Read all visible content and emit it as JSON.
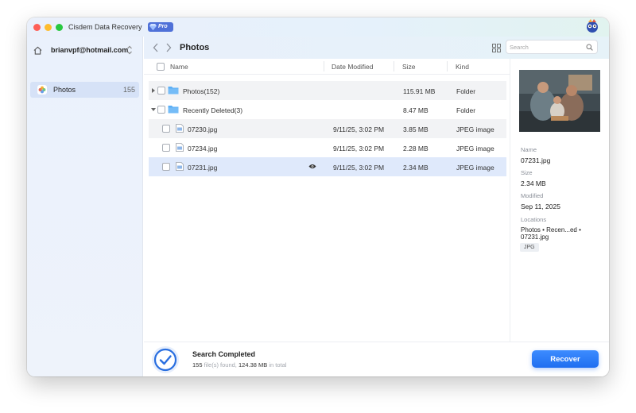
{
  "window": {
    "title": "Cisdem Data Recovery",
    "badge": "Pro"
  },
  "sidebar": {
    "account_email": "brianvpf@hotmail.com",
    "items": [
      {
        "label": "Photos",
        "count": "155",
        "icon": "photos-app-icon",
        "selected": true
      }
    ]
  },
  "toolbar": {
    "title": "Photos",
    "search_placeholder": "Search"
  },
  "table": {
    "columns": [
      "Name",
      "Date Modified",
      "Size",
      "Kind"
    ],
    "rows": [
      {
        "name": "Photos(152)",
        "date": "",
        "size": "115.91 MB",
        "kind": "Folder",
        "type": "folder",
        "expanded": false
      },
      {
        "name": "Recently Deleted(3)",
        "date": "",
        "size": "8.47 MB",
        "kind": "Folder",
        "type": "folder",
        "expanded": true
      },
      {
        "name": "07230.jpg",
        "date": "9/11/25, 3:02 PM",
        "size": "3.85 MB",
        "kind": "JPEG image",
        "type": "file"
      },
      {
        "name": "07234.jpg",
        "date": "9/11/25, 3:02 PM",
        "size": "2.28 MB",
        "kind": "JPEG image",
        "type": "file"
      },
      {
        "name": "07231.jpg",
        "date": "9/11/25, 3:02 PM",
        "size": "2.34 MB",
        "kind": "JPEG image",
        "type": "file",
        "selected": true
      }
    ]
  },
  "details": {
    "name_label": "Name",
    "name_value": "07231.jpg",
    "size_label": "Size",
    "size_value": "2.34 MB",
    "modified_label": "Modified",
    "modified_value": "Sep 11, 2025",
    "locations_label": "Locations",
    "locations_value": "Photos • Recen...ed • 07231.jpg",
    "tag": "JPG"
  },
  "footer": {
    "status_title": "Search Completed",
    "files_count": "155",
    "files_text": "file(s) found,",
    "total_size": "124.38 MB",
    "total_text": "in total",
    "recover_label": "Recover"
  },
  "colors": {
    "accent": "#1f6ef0",
    "selection": "#dfe9fb",
    "sidebar_selected": "#d6e2f7",
    "folder": "#5aaef5"
  }
}
